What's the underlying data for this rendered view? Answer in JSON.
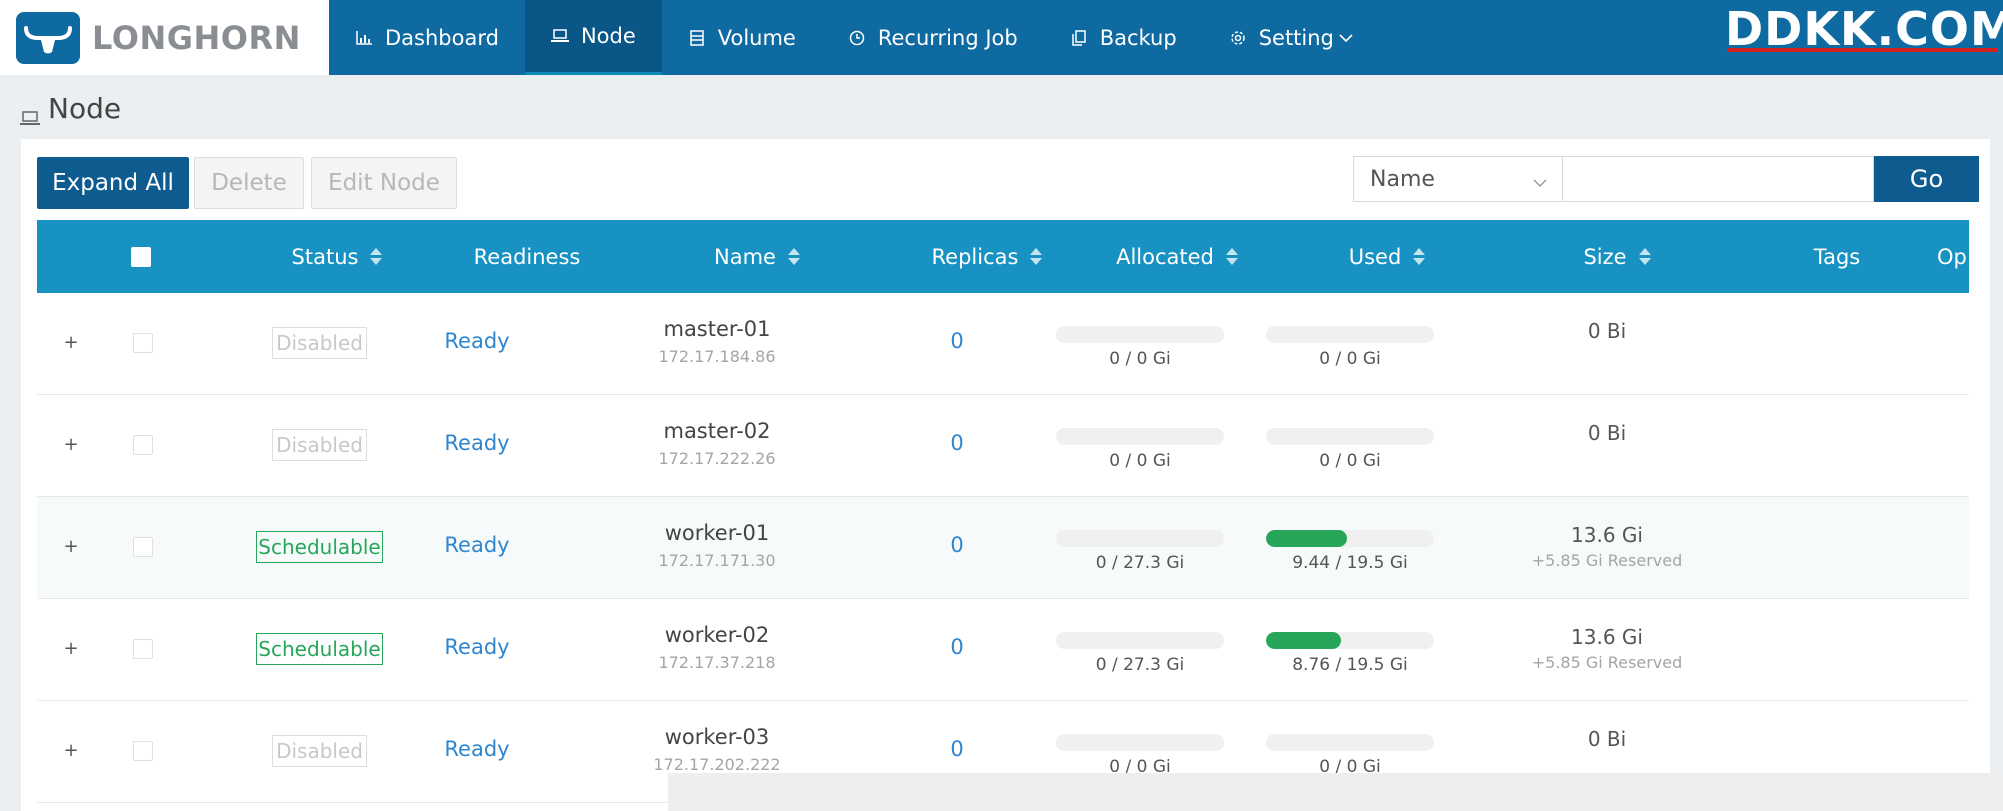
{
  "app": {
    "logo_text": "LONGHORN",
    "watermark": "DDKK.COM"
  },
  "nav": {
    "items": [
      {
        "label": "Dashboard",
        "icon": "bar-chart-icon"
      },
      {
        "label": "Node",
        "icon": "laptop-icon",
        "active": true
      },
      {
        "label": "Volume",
        "icon": "database-icon"
      },
      {
        "label": "Recurring Job",
        "icon": "clock-icon"
      },
      {
        "label": "Backup",
        "icon": "copy-icon"
      },
      {
        "label": "Setting",
        "icon": "gear-icon"
      }
    ]
  },
  "page": {
    "title": "Node"
  },
  "toolbar": {
    "expand_all": "Expand All",
    "delete": "Delete",
    "edit_node": "Edit Node"
  },
  "search": {
    "field_value": "Name",
    "input_value": "",
    "go": "Go"
  },
  "table": {
    "headers": {
      "status": "Status",
      "readiness": "Readiness",
      "name": "Name",
      "replicas": "Replicas",
      "allocated": "Allocated",
      "used": "Used",
      "size": "Size",
      "tags": "Tags",
      "operation": "Op"
    },
    "rows": [
      {
        "status": "Disabled",
        "readiness": "Ready",
        "name": "master-01",
        "ip": "172.17.184.86",
        "replicas": "0",
        "allocated": "0 / 0 Gi",
        "allocated_ratio": 0,
        "used": "0 / 0 Gi",
        "used_ratio": 0,
        "size": "0 Bi",
        "reserved": ""
      },
      {
        "status": "Disabled",
        "readiness": "Ready",
        "name": "master-02",
        "ip": "172.17.222.26",
        "replicas": "0",
        "allocated": "0 / 0 Gi",
        "allocated_ratio": 0,
        "used": "0 / 0 Gi",
        "used_ratio": 0,
        "size": "0 Bi",
        "reserved": ""
      },
      {
        "status": "Schedulable",
        "readiness": "Ready",
        "name": "worker-01",
        "ip": "172.17.171.30",
        "replicas": "0",
        "allocated": "0 / 27.3 Gi",
        "allocated_ratio": 0,
        "used": "9.44 / 19.5 Gi",
        "used_ratio": 0.484,
        "size": "13.6 Gi",
        "reserved": "+5.85 Gi Reserved"
      },
      {
        "status": "Schedulable",
        "readiness": "Ready",
        "name": "worker-02",
        "ip": "172.17.37.218",
        "replicas": "0",
        "allocated": "0 / 27.3 Gi",
        "allocated_ratio": 0,
        "used": "8.76 / 19.5 Gi",
        "used_ratio": 0.449,
        "size": "13.6 Gi",
        "reserved": "+5.85 Gi Reserved"
      },
      {
        "status": "Disabled",
        "readiness": "Ready",
        "name": "worker-03",
        "ip": "172.17.202.222",
        "replicas": "0",
        "allocated": "0 / 0 Gi",
        "allocated_ratio": 0,
        "used": "0 / 0 Gi",
        "used_ratio": 0,
        "size": "0 Bi",
        "reserved": ""
      }
    ]
  },
  "colors": {
    "nav_bg": "#0e6aa0",
    "header_bg": "#1792c3",
    "primary": "#0e5c8f",
    "green": "#27a65a",
    "link": "#2f86cf"
  }
}
